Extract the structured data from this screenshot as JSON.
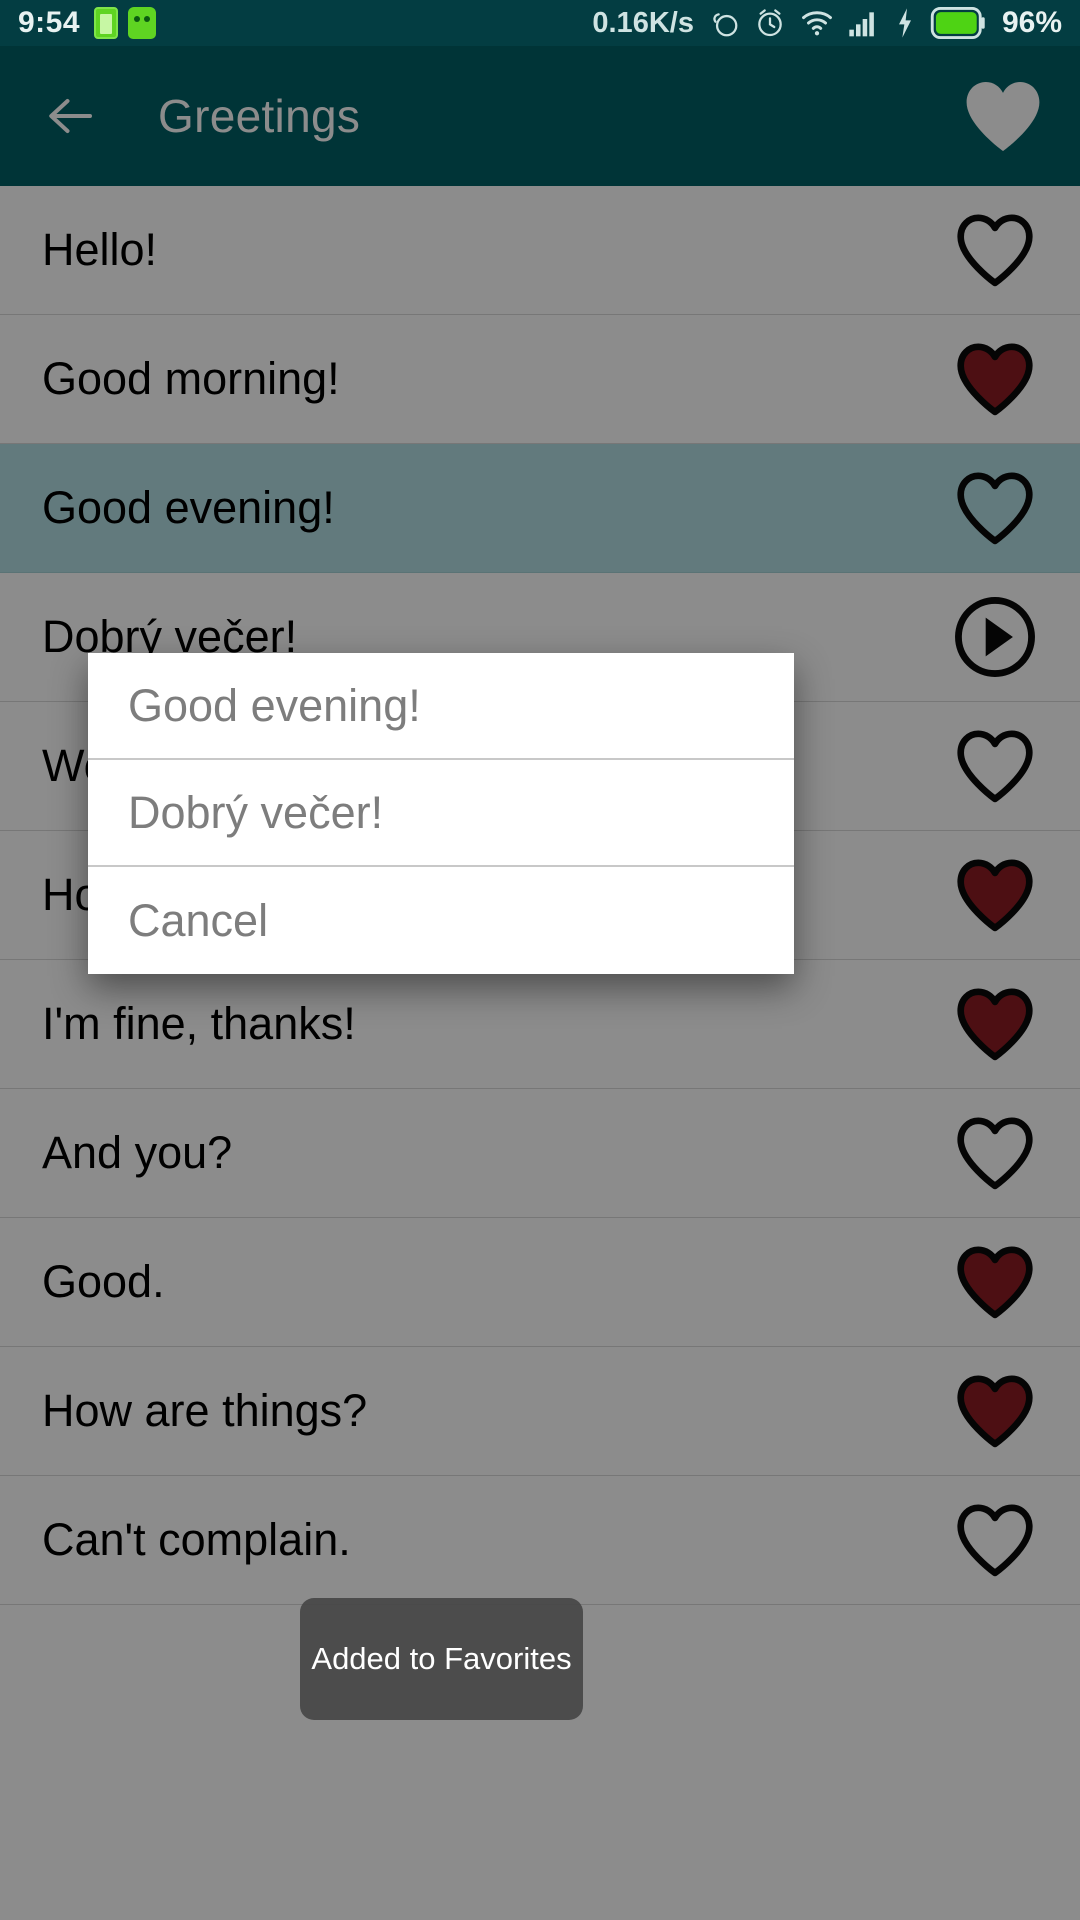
{
  "statusbar": {
    "time": "9:54",
    "network_speed": "0.16K/s",
    "battery_percent": "96%",
    "icons": [
      "battery-small-icon",
      "android-robot-icon",
      "rotation-icon",
      "alarm-clock-icon",
      "wifi-icon",
      "cell-signal-icon",
      "charging-bolt-icon",
      "battery-icon"
    ]
  },
  "appbar": {
    "title": "Greetings",
    "back_label": "Back",
    "favorite_label": "Favorites"
  },
  "list": {
    "rows": [
      {
        "label": "Hello!",
        "favorite": false,
        "selected": false,
        "icon": "heart-outline-icon"
      },
      {
        "label": "Good morning!",
        "favorite": true,
        "selected": false,
        "icon": "heart-filled-icon"
      },
      {
        "label": "Good evening!",
        "favorite": false,
        "selected": true,
        "icon": "heart-outline-icon"
      },
      {
        "label": "Dobrý večer!",
        "favorite": false,
        "selected": false,
        "icon": "play-circle-icon"
      },
      {
        "label": "Welcome!",
        "favorite": false,
        "selected": false,
        "icon": "heart-outline-icon"
      },
      {
        "label": "How are you?",
        "favorite": true,
        "selected": false,
        "icon": "heart-filled-icon"
      },
      {
        "label": "I'm fine, thanks!",
        "favorite": true,
        "selected": false,
        "icon": "heart-filled-icon"
      },
      {
        "label": "And you?",
        "favorite": false,
        "selected": false,
        "icon": "heart-outline-icon"
      },
      {
        "label": "Good.",
        "favorite": true,
        "selected": false,
        "icon": "heart-filled-icon"
      },
      {
        "label": "How are things?",
        "favorite": true,
        "selected": false,
        "icon": "heart-filled-icon"
      },
      {
        "label": "Can't complain.",
        "favorite": false,
        "selected": false,
        "icon": "heart-outline-icon"
      }
    ]
  },
  "dialog": {
    "items": [
      {
        "label": "Good evening!"
      },
      {
        "label": "Dobrý večer!"
      },
      {
        "label": "Cancel"
      }
    ]
  },
  "toast": {
    "message": "Added to Favorites"
  },
  "colors": {
    "appbar": "#006064",
    "statusbar": "#033d42",
    "selected_row": "#b2dfe3",
    "heart_filled": "#8c1c24",
    "toast_bg": "#464646"
  }
}
